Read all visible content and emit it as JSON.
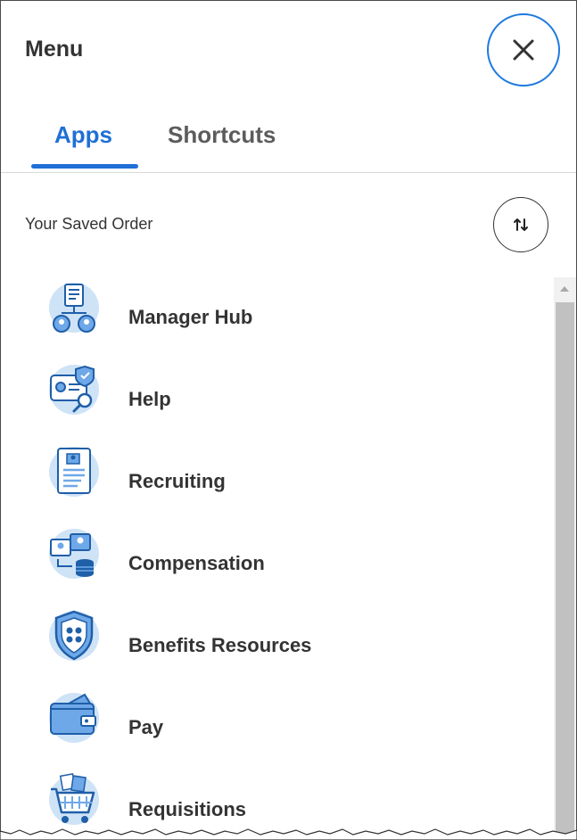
{
  "header": {
    "title": "Menu",
    "close_icon": "close-icon"
  },
  "tabs": [
    {
      "label": "Apps",
      "active": true
    },
    {
      "label": "Shortcuts",
      "active": false
    }
  ],
  "section": {
    "label": "Your Saved Order",
    "sort_icon": "sort-arrows-icon"
  },
  "apps": [
    {
      "label": "Manager Hub",
      "icon": "manager-hub-icon"
    },
    {
      "label": "Help",
      "icon": "help-icon"
    },
    {
      "label": "Recruiting",
      "icon": "recruiting-icon"
    },
    {
      "label": "Compensation",
      "icon": "compensation-icon"
    },
    {
      "label": "Benefits Resources",
      "icon": "benefits-shield-icon"
    },
    {
      "label": "Pay",
      "icon": "pay-wallet-icon"
    },
    {
      "label": "Requisitions",
      "icon": "requisitions-cart-icon"
    }
  ],
  "colors": {
    "accent": "#1f6fd6",
    "icon_light": "#cfe3f7",
    "icon_mid": "#6fa8e8",
    "icon_dark": "#1f5fa8"
  }
}
